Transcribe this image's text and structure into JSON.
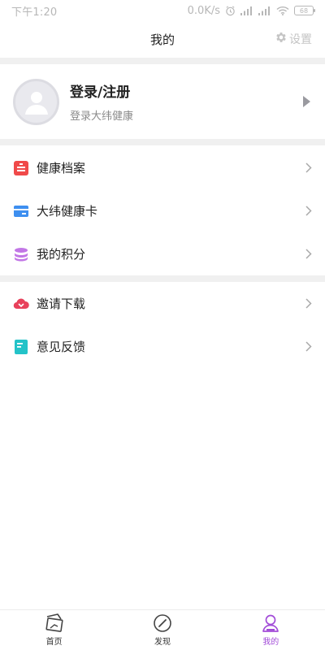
{
  "status_bar": {
    "time": "下午1:20",
    "network_speed": "0.0K/s",
    "battery": "68"
  },
  "header": {
    "title": "我的",
    "settings_label": "设置"
  },
  "profile": {
    "title": "登录/注册",
    "subtitle": "登录大纬健康"
  },
  "menu": {
    "group1": [
      {
        "label": "健康档案",
        "icon": "health-record-icon",
        "color": "#f04a4a"
      },
      {
        "label": "大纬健康卡",
        "icon": "health-card-icon",
        "color": "#3e8ff0"
      },
      {
        "label": "我的积分",
        "icon": "points-icon",
        "color": "#c277e6"
      }
    ],
    "group2": [
      {
        "label": "邀请下载",
        "icon": "invite-download-icon",
        "color": "#e8415b"
      },
      {
        "label": "意见反馈",
        "icon": "feedback-icon",
        "color": "#23c3c8"
      }
    ]
  },
  "bottom_nav": [
    {
      "label": "首页",
      "icon": "home-icon"
    },
    {
      "label": "发现",
      "icon": "discover-icon"
    },
    {
      "label": "我的",
      "icon": "profile-icon",
      "active": true
    }
  ],
  "colors": {
    "accent": "#a24bd8",
    "separator": "#f0f0f0",
    "muted_text": "#8a8a8a"
  }
}
